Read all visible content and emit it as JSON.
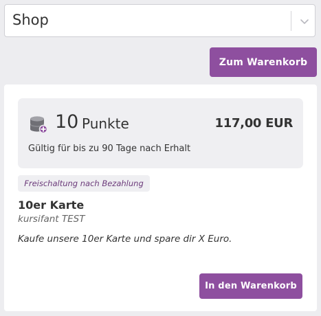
{
  "shop_select": {
    "selected": "Shop"
  },
  "header": {
    "cart_button_label": "Zum Warenkorb"
  },
  "product": {
    "points_value": "10",
    "points_unit": "Punkte",
    "price": "117,00 EUR",
    "validity": "Gültig für bis zu 90 Tage nach Erhalt",
    "badge": "Freischaltung nach Bezahlung",
    "title": "10er Karte",
    "owner": "kursifant TEST",
    "description": "Kaufe unsere 10er Karte und spare dir X Euro.",
    "add_to_cart_label": "In den Warenkorb"
  },
  "icons": {
    "points": "coins-icon",
    "select_arrow": "chevron-down-icon"
  },
  "colors": {
    "accent": "#8e4f9f",
    "background": "#ededf0",
    "panel": "#efeff2",
    "badge_text": "#6b3a7a"
  }
}
